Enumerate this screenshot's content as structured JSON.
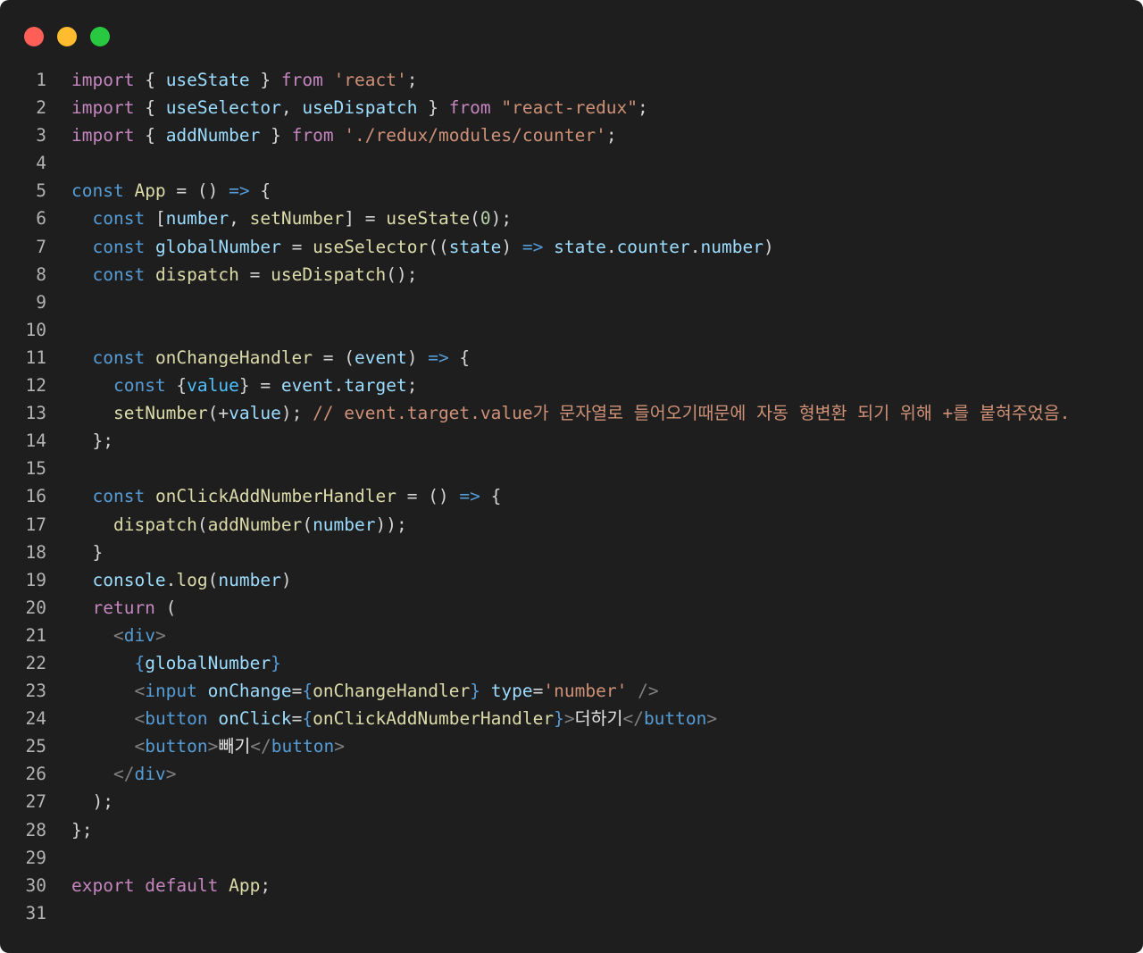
{
  "window": {
    "controls": [
      "close",
      "minimize",
      "maximize"
    ],
    "colors": {
      "background": "#1e1e1e",
      "close": "#ff5f57",
      "minimize": "#febc2e",
      "maximize": "#28c840"
    }
  },
  "code_lines": [
    {
      "n": "1",
      "tokens": [
        [
          "kw",
          "import"
        ],
        [
          "pl",
          " { "
        ],
        [
          "vr",
          "useState"
        ],
        [
          "pl",
          " } "
        ],
        [
          "kw",
          "from"
        ],
        [
          "pl",
          " "
        ],
        [
          "st",
          "'react'"
        ],
        [
          "pl",
          ";"
        ]
      ]
    },
    {
      "n": "2",
      "tokens": [
        [
          "kw",
          "import"
        ],
        [
          "pl",
          " { "
        ],
        [
          "vr",
          "useSelector"
        ],
        [
          "pl",
          ", "
        ],
        [
          "vr",
          "useDispatch"
        ],
        [
          "pl",
          " } "
        ],
        [
          "kw",
          "from"
        ],
        [
          "pl",
          " "
        ],
        [
          "st",
          "\"react-redux\""
        ],
        [
          "pl",
          ";"
        ]
      ]
    },
    {
      "n": "3",
      "tokens": [
        [
          "kw",
          "import"
        ],
        [
          "pl",
          " { "
        ],
        [
          "vr",
          "addNumber"
        ],
        [
          "pl",
          " } "
        ],
        [
          "kw",
          "from"
        ],
        [
          "pl",
          " "
        ],
        [
          "st",
          "'./redux/modules/counter'"
        ],
        [
          "pl",
          ";"
        ]
      ]
    },
    {
      "n": "4",
      "tokens": []
    },
    {
      "n": "5",
      "tokens": [
        [
          "sto",
          "const"
        ],
        [
          "pl",
          " "
        ],
        [
          "fn",
          "App"
        ],
        [
          "pl",
          " = () "
        ],
        [
          "ar",
          "=>"
        ],
        [
          "pl",
          " {"
        ]
      ]
    },
    {
      "n": "6",
      "tokens": [
        [
          "pl",
          "  "
        ],
        [
          "sto",
          "const"
        ],
        [
          "pl",
          " ["
        ],
        [
          "vr",
          "number"
        ],
        [
          "pl",
          ", "
        ],
        [
          "fn",
          "setNumber"
        ],
        [
          "pl",
          "] = "
        ],
        [
          "fn",
          "useState"
        ],
        [
          "pl",
          "("
        ],
        [
          "num",
          "0"
        ],
        [
          "pl",
          ");"
        ]
      ]
    },
    {
      "n": "7",
      "tokens": [
        [
          "pl",
          "  "
        ],
        [
          "sto",
          "const"
        ],
        [
          "pl",
          " "
        ],
        [
          "vr",
          "globalNumber"
        ],
        [
          "pl",
          " = "
        ],
        [
          "fn",
          "useSelector"
        ],
        [
          "pl",
          "(("
        ],
        [
          "vr",
          "state"
        ],
        [
          "pl",
          ") "
        ],
        [
          "ar",
          "=>"
        ],
        [
          "pl",
          " "
        ],
        [
          "vr",
          "state"
        ],
        [
          "pl",
          "."
        ],
        [
          "vr",
          "counter"
        ],
        [
          "pl",
          "."
        ],
        [
          "vr",
          "number"
        ],
        [
          "pl",
          ")"
        ]
      ]
    },
    {
      "n": "8",
      "tokens": [
        [
          "pl",
          "  "
        ],
        [
          "sto",
          "const"
        ],
        [
          "pl",
          " "
        ],
        [
          "fn",
          "dispatch"
        ],
        [
          "pl",
          " = "
        ],
        [
          "fn",
          "useDispatch"
        ],
        [
          "pl",
          "();"
        ]
      ]
    },
    {
      "n": "9",
      "tokens": []
    },
    {
      "n": "10",
      "tokens": []
    },
    {
      "n": "11",
      "tokens": [
        [
          "pl",
          "  "
        ],
        [
          "sto",
          "const"
        ],
        [
          "pl",
          " "
        ],
        [
          "fn",
          "onChangeHandler"
        ],
        [
          "pl",
          " = ("
        ],
        [
          "vr",
          "event"
        ],
        [
          "pl",
          ") "
        ],
        [
          "ar",
          "=>"
        ],
        [
          "pl",
          " {"
        ]
      ]
    },
    {
      "n": "12",
      "tokens": [
        [
          "pl",
          "    "
        ],
        [
          "sto",
          "const"
        ],
        [
          "pl",
          " {"
        ],
        [
          "cnst",
          "value"
        ],
        [
          "pl",
          "} = "
        ],
        [
          "vr",
          "event"
        ],
        [
          "pl",
          "."
        ],
        [
          "vr",
          "target"
        ],
        [
          "pl",
          ";"
        ]
      ]
    },
    {
      "n": "13",
      "tokens": [
        [
          "pl",
          "    "
        ],
        [
          "fn",
          "setNumber"
        ],
        [
          "pl",
          "(+"
        ],
        [
          "vr",
          "value"
        ],
        [
          "pl",
          "); "
        ],
        [
          "cm",
          "// event.target.value가 문자열로 들어오기때문에 자동 형변환 되기 위해 +를 붙혀주었음."
        ]
      ]
    },
    {
      "n": "14",
      "tokens": [
        [
          "pl",
          "  };"
        ]
      ]
    },
    {
      "n": "15",
      "tokens": []
    },
    {
      "n": "16",
      "tokens": [
        [
          "pl",
          "  "
        ],
        [
          "sto",
          "const"
        ],
        [
          "pl",
          " "
        ],
        [
          "fn",
          "onClickAddNumberHandler"
        ],
        [
          "pl",
          " = () "
        ],
        [
          "ar",
          "=>"
        ],
        [
          "pl",
          " {"
        ]
      ]
    },
    {
      "n": "17",
      "tokens": [
        [
          "pl",
          "    "
        ],
        [
          "fn",
          "dispatch"
        ],
        [
          "pl",
          "("
        ],
        [
          "fn",
          "addNumber"
        ],
        [
          "pl",
          "("
        ],
        [
          "vr",
          "number"
        ],
        [
          "pl",
          "));"
        ]
      ]
    },
    {
      "n": "18",
      "tokens": [
        [
          "pl",
          "  }"
        ]
      ]
    },
    {
      "n": "19",
      "tokens": [
        [
          "pl",
          "  "
        ],
        [
          "vr",
          "console"
        ],
        [
          "pl",
          "."
        ],
        [
          "fn",
          "log"
        ],
        [
          "pl",
          "("
        ],
        [
          "vr",
          "number"
        ],
        [
          "pl",
          ")"
        ]
      ]
    },
    {
      "n": "20",
      "tokens": [
        [
          "pl",
          "  "
        ],
        [
          "kw",
          "return"
        ],
        [
          "pl",
          " ("
        ]
      ]
    },
    {
      "n": "21",
      "tokens": [
        [
          "pl",
          "    "
        ],
        [
          "br",
          "<"
        ],
        [
          "tg",
          "div"
        ],
        [
          "br",
          ">"
        ]
      ]
    },
    {
      "n": "22",
      "tokens": [
        [
          "pl",
          "      "
        ],
        [
          "sto",
          "{"
        ],
        [
          "vr",
          "globalNumber"
        ],
        [
          "sto",
          "}"
        ]
      ]
    },
    {
      "n": "23",
      "tokens": [
        [
          "pl",
          "      "
        ],
        [
          "br",
          "<"
        ],
        [
          "tg",
          "input"
        ],
        [
          "pl",
          " "
        ],
        [
          "vr",
          "onChange"
        ],
        [
          "pl",
          "="
        ],
        [
          "sto",
          "{"
        ],
        [
          "fn",
          "onChangeHandler"
        ],
        [
          "sto",
          "}"
        ],
        [
          "pl",
          " "
        ],
        [
          "vr",
          "type"
        ],
        [
          "pl",
          "="
        ],
        [
          "st",
          "'number'"
        ],
        [
          "pl",
          " "
        ],
        [
          "br",
          "/>"
        ]
      ]
    },
    {
      "n": "24",
      "tokens": [
        [
          "pl",
          "      "
        ],
        [
          "br",
          "<"
        ],
        [
          "tg",
          "button"
        ],
        [
          "pl",
          " "
        ],
        [
          "vr",
          "onClick"
        ],
        [
          "pl",
          "="
        ],
        [
          "sto",
          "{"
        ],
        [
          "fn",
          "onClickAddNumberHandler"
        ],
        [
          "sto",
          "}"
        ],
        [
          "br",
          ">"
        ],
        [
          "hn",
          "더하기"
        ],
        [
          "br",
          "</"
        ],
        [
          "tg",
          "button"
        ],
        [
          "br",
          ">"
        ]
      ]
    },
    {
      "n": "25",
      "tokens": [
        [
          "pl",
          "      "
        ],
        [
          "br",
          "<"
        ],
        [
          "tg",
          "button"
        ],
        [
          "br",
          ">"
        ],
        [
          "hn",
          "빼기"
        ],
        [
          "br",
          "</"
        ],
        [
          "tg",
          "button"
        ],
        [
          "br",
          ">"
        ]
      ]
    },
    {
      "n": "26",
      "tokens": [
        [
          "pl",
          "    "
        ],
        [
          "br",
          "</"
        ],
        [
          "tg",
          "div"
        ],
        [
          "br",
          ">"
        ]
      ]
    },
    {
      "n": "27",
      "tokens": [
        [
          "pl",
          "  );"
        ]
      ]
    },
    {
      "n": "28",
      "tokens": [
        [
          "pl",
          "};"
        ]
      ]
    },
    {
      "n": "29",
      "tokens": []
    },
    {
      "n": "30",
      "tokens": [
        [
          "kw",
          "export"
        ],
        [
          "pl",
          " "
        ],
        [
          "kw",
          "default"
        ],
        [
          "pl",
          " "
        ],
        [
          "fn",
          "App"
        ],
        [
          "pl",
          ";"
        ]
      ]
    },
    {
      "n": "31",
      "tokens": []
    }
  ]
}
